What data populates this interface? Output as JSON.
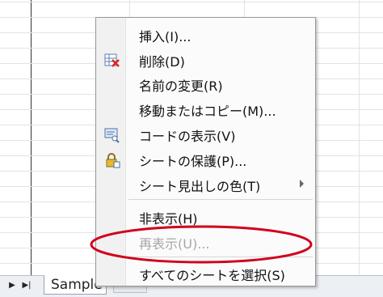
{
  "sheet_tab": {
    "label": "Sample"
  },
  "nav": {
    "next": "▶",
    "last": "▶|"
  },
  "menu": {
    "items": [
      {
        "label": "挿入(I)..."
      },
      {
        "label": "削除(D)"
      },
      {
        "label": "名前の変更(R)"
      },
      {
        "label": "移動またはコピー(M)..."
      },
      {
        "label": "コードの表示(V)"
      },
      {
        "label": "シートの保護(P)..."
      },
      {
        "label": "シート見出しの色(T)"
      },
      {
        "label": "非表示(H)"
      },
      {
        "label": "再表示(U)..."
      },
      {
        "label": "すべてのシートを選択(S)"
      }
    ]
  },
  "colors": {
    "annotation": "#d0021b",
    "disabled_text": "#a6a6a6"
  }
}
